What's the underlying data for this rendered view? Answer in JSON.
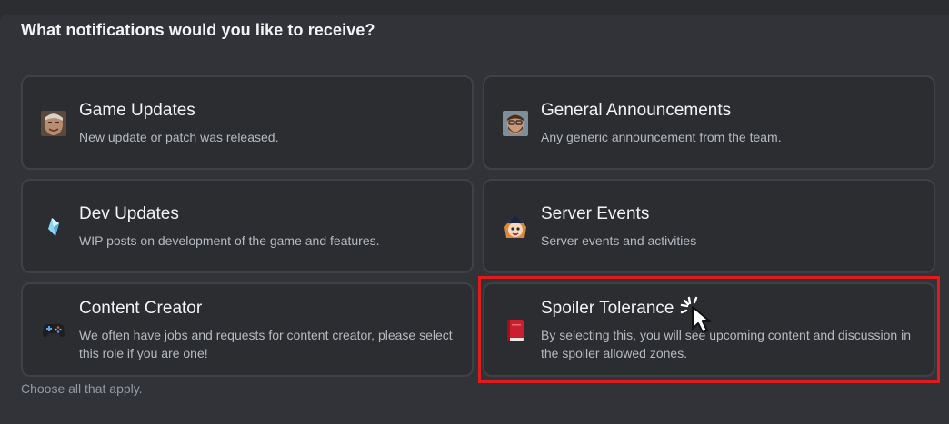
{
  "question": "What notifications would you like to receive?",
  "hint": "Choose all that apply.",
  "options": [
    {
      "title": "Game Updates",
      "description": "New update or patch was released.",
      "icon": "old-man-face-icon"
    },
    {
      "title": "General Announcements",
      "description": "Any generic announcement from the team.",
      "icon": "bearded-man-face-icon"
    },
    {
      "title": "Dev Updates",
      "description": "WIP posts on development of the game and features.",
      "icon": "crystal-icon"
    },
    {
      "title": "Server Events",
      "description": "Server events and activities",
      "icon": "anime-character-icon"
    },
    {
      "title": "Content Creator",
      "description": "We often have jobs and requests for content creator, please select this role if you are one!",
      "icon": "gamepad-icon"
    },
    {
      "title": "Spoiler Tolerance",
      "description": "By selecting this, you will see upcoming content and discussion in the spoiler allowed zones.",
      "icon": "red-book-icon"
    }
  ],
  "colors": {
    "background": "#2b2d31",
    "panel": "#313338",
    "card_border": "#3f4147",
    "highlight": "#e01b1b"
  }
}
